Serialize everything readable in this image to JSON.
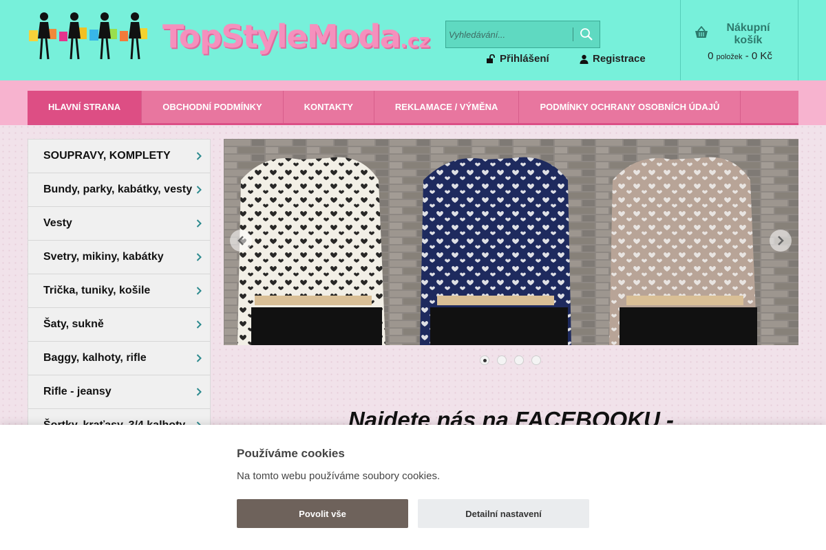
{
  "header": {
    "logo_text": "TopStyleModa",
    "logo_tld": ".cz",
    "search_placeholder": "Vyhledávání...",
    "login_label": "Přihlášení",
    "register_label": "Registrace",
    "cart": {
      "title": "Nákupní košík",
      "count": "0",
      "count_unit": "položek",
      "separator": "-",
      "total": "0 Kč"
    }
  },
  "nav": {
    "items": [
      {
        "label": "HLAVNÍ STRANA",
        "active": true
      },
      {
        "label": "OBCHODNÍ PODMÍNKY"
      },
      {
        "label": "KONTAKTY"
      },
      {
        "label": "REKLAMACE / VÝMĚNA"
      },
      {
        "label": "PODMÍNKY OCHRANY OSOBNÍCH ÚDAJŮ"
      }
    ]
  },
  "sidebar": {
    "categories": [
      {
        "label": "SOUPRAVY, KOMPLETY"
      },
      {
        "label": "Bundy, parky, kabátky, vesty"
      },
      {
        "label": "Vesty"
      },
      {
        "label": "Svetry, mikiny, kabátky"
      },
      {
        "label": "Trička, tuniky, košile"
      },
      {
        "label": "Šaty, sukně"
      },
      {
        "label": "Baggy, kalhoty, rifle"
      },
      {
        "label": "Rifle - jeansy"
      },
      {
        "label": "Šortky, kraťasy, 3/4 kalhoty"
      }
    ]
  },
  "slider": {
    "slides_count": 4,
    "active_index": 0
  },
  "content": {
    "facebook_heading": "Najdete nás na FACEBOOKU -"
  },
  "cookies": {
    "title": "Používáme cookies",
    "text": "Na tomto webu používáme soubory cookies.",
    "allow_label": "Povolit vše",
    "detail_label": "Detailní nastavení"
  },
  "colors": {
    "header_bg": "#77f0da",
    "nav_pink": "#e8769f",
    "nav_active": "#dd4e84",
    "logo_pink": "#f590bd",
    "allow_button": "#6e625b"
  }
}
